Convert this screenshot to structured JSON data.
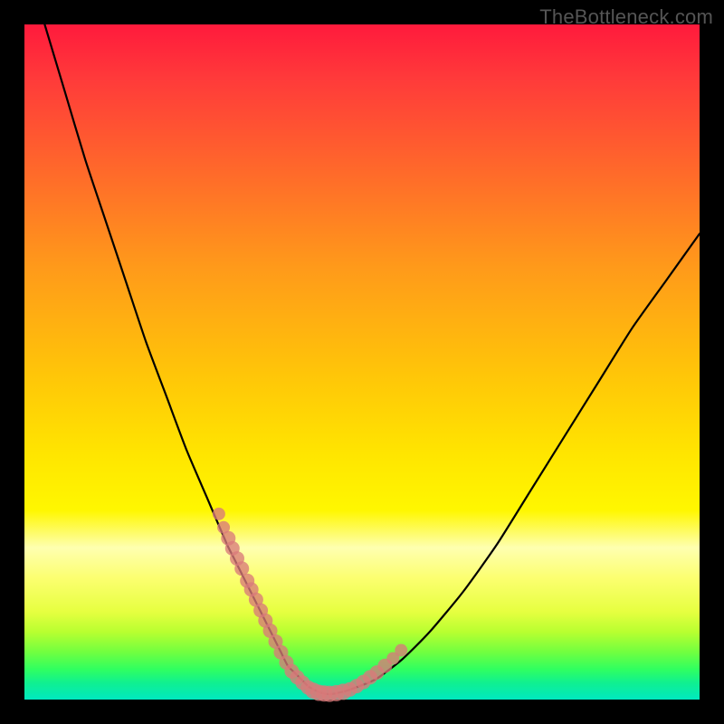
{
  "watermark": "TheBottleneck.com",
  "colors": {
    "background": "#000000",
    "curve": "#000000",
    "marker": "#d97a7a"
  },
  "chart_data": {
    "type": "line",
    "title": "",
    "xlabel": "",
    "ylabel": "",
    "xlim": [
      0,
      100
    ],
    "ylim": [
      0,
      100
    ],
    "grid": false,
    "series": [
      {
        "name": "bottleneck-curve",
        "x": [
          3,
          6,
          9,
          12,
          15,
          18,
          21,
          24,
          27,
          30,
          31,
          32,
          33,
          34,
          35,
          36,
          37,
          38,
          39,
          40,
          41,
          42,
          43,
          44,
          45,
          46,
          48,
          52,
          56,
          60,
          65,
          70,
          75,
          80,
          85,
          90,
          95,
          100
        ],
        "y": [
          100,
          90,
          80,
          71,
          62,
          53,
          45,
          37,
          30,
          23,
          21,
          19,
          17,
          15,
          13,
          11,
          9,
          7,
          5,
          4,
          3,
          2,
          1.4,
          1,
          0.8,
          0.9,
          1.4,
          3,
          6,
          10,
          16,
          23,
          31,
          39,
          47,
          55,
          62,
          69
        ]
      }
    ],
    "markers": {
      "name": "highlight-points",
      "x": [
        28.8,
        29.5,
        30.2,
        30.8,
        31.5,
        32.2,
        33.0,
        33.6,
        34.3,
        35.0,
        35.7,
        36.4,
        37.2,
        38.0,
        38.8,
        39.6,
        40.4,
        41.2,
        42.0,
        42.8,
        43.6,
        44.4,
        45.2,
        46.2,
        47.2,
        48.2,
        49.2,
        50.2,
        51.2,
        52.2,
        53.4,
        54.6,
        55.8
      ],
      "y": [
        27.5,
        25.5,
        23.9,
        22.4,
        20.9,
        19.4,
        17.6,
        16.3,
        14.8,
        13.2,
        11.7,
        10.2,
        8.6,
        7.0,
        5.5,
        4.2,
        3.3,
        2.5,
        1.8,
        1.3,
        1.0,
        0.9,
        0.85,
        0.95,
        1.15,
        1.5,
        2.0,
        2.6,
        3.3,
        4.0,
        5.0,
        6.1,
        7.3
      ],
      "r": [
        7,
        7,
        8,
        8,
        8,
        8,
        8,
        8,
        8,
        8,
        8,
        8,
        8,
        8,
        8,
        8,
        8,
        8,
        8,
        9,
        9,
        9,
        9,
        9,
        9,
        8,
        8,
        8,
        8,
        8,
        8,
        7,
        7
      ]
    }
  }
}
